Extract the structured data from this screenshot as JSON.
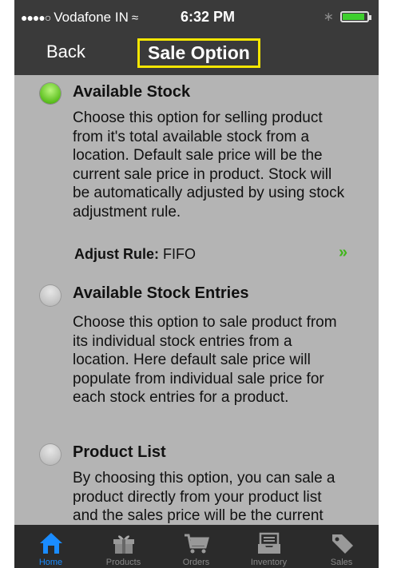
{
  "status_bar": {
    "signal_dots": "●●●●○",
    "carrier": "Vodafone IN",
    "time": "6:32 PM",
    "battery_level": 0.9
  },
  "nav": {
    "back_label": "Back",
    "title": "Sale Option"
  },
  "options": [
    {
      "title": "Available Stock",
      "selected": true,
      "description": "Choose this option for selling product from it's total available stock from a location. Default sale price will be the current sale price in product. Stock will be automatically adjusted by using stock adjustment rule.",
      "adjust_rule_label": "Adjust Rule:",
      "adjust_rule_value": "FIFO"
    },
    {
      "title": "Available Stock Entries",
      "selected": false,
      "description": "Choose this option to sale product from its individual stock entries from a location. Here default sale price will populate from individual sale price for each stock entries for a product."
    },
    {
      "title": "Product List",
      "selected": false,
      "description": "By choosing this option, you can sale a product directly from your product list and the sales price will be the current sale price set in a product."
    }
  ],
  "tabs": [
    {
      "label": "Home",
      "icon": "home-icon",
      "active": true
    },
    {
      "label": "Products",
      "icon": "gift-box-icon",
      "active": false
    },
    {
      "label": "Orders",
      "icon": "cart-icon",
      "active": false
    },
    {
      "label": "Inventory",
      "icon": "inbox-tray-icon",
      "active": false
    },
    {
      "label": "Sales",
      "icon": "price-tag-icon",
      "active": false
    }
  ],
  "colors": {
    "accent_green": "#3fb51a",
    "active_tab_blue": "#1a8cff",
    "title_highlight": "#f5e600"
  }
}
